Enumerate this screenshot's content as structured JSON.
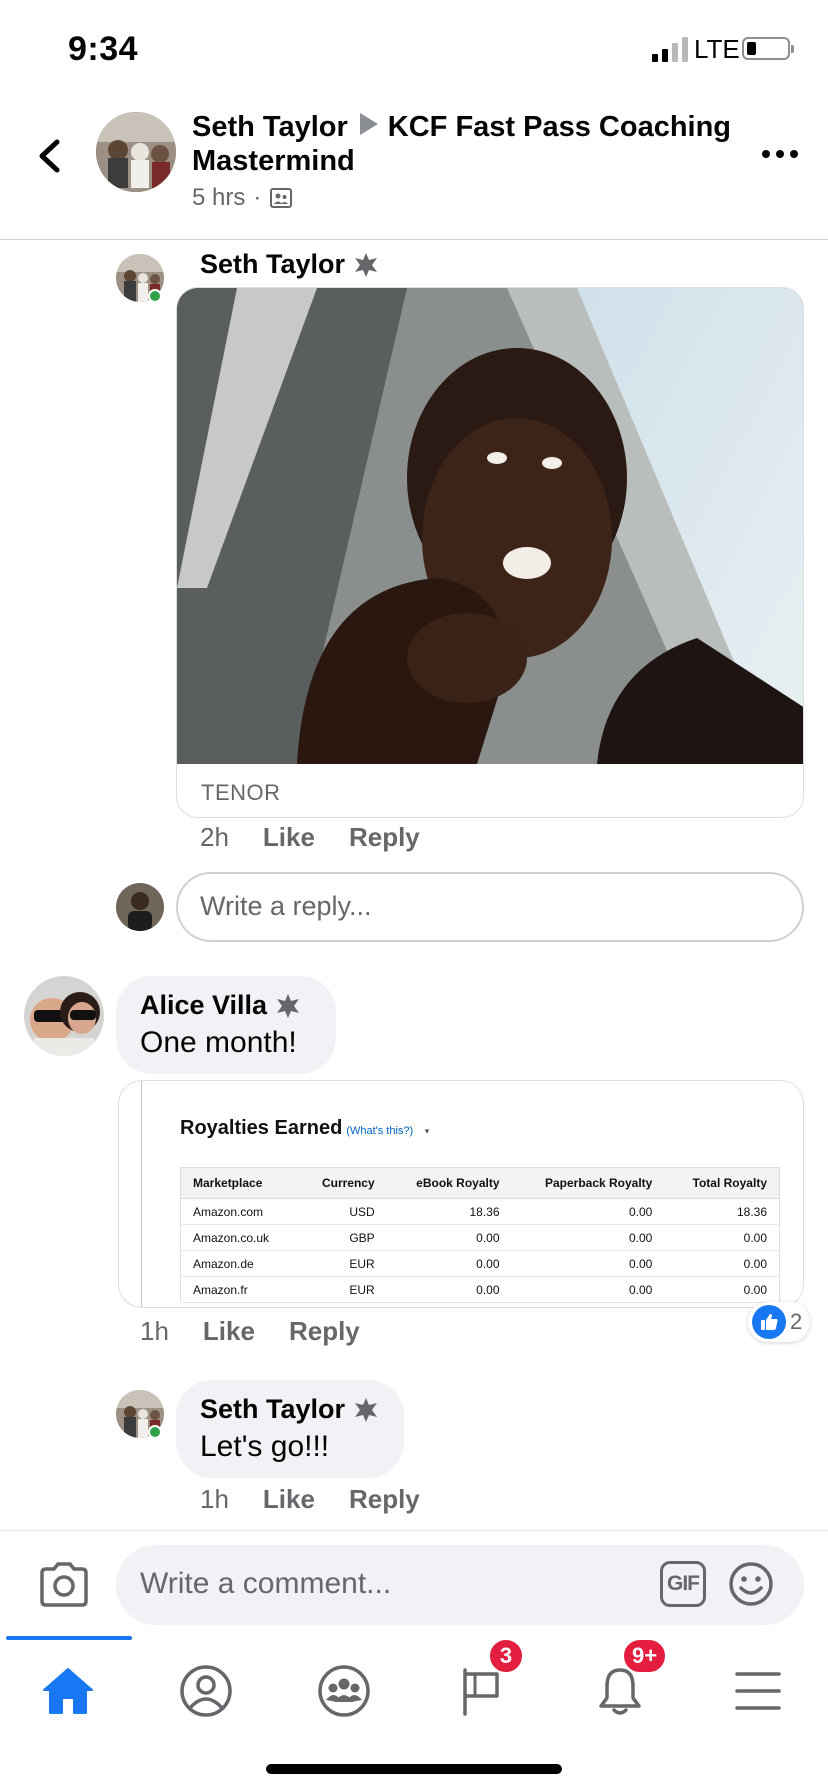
{
  "status_bar": {
    "time": "9:34",
    "network": "LTE"
  },
  "header": {
    "author": "Seth Taylor",
    "group": "KCF Fast Pass Coaching Mastermind",
    "time": "5 hrs",
    "audience_icon": "group-privacy-icon"
  },
  "comments": [
    {
      "author": "Seth Taylor",
      "attachment": {
        "type": "gif",
        "source": "TENOR"
      },
      "actions": {
        "time": "2h",
        "like": "Like",
        "reply": "Reply"
      }
    },
    {
      "author": "Alice Villa",
      "text": "One month!",
      "attachment": {
        "type": "image",
        "title": "Royalties Earned",
        "link": "(What's this?)",
        "columns": [
          "Marketplace",
          "Currency",
          "eBook Royalty",
          "Paperback Royalty",
          "Total Royalty"
        ],
        "rows": [
          [
            "Amazon.com",
            "USD",
            "18.36",
            "0.00",
            "18.36"
          ],
          [
            "Amazon.co.uk",
            "GBP",
            "0.00",
            "0.00",
            "0.00"
          ],
          [
            "Amazon.de",
            "EUR",
            "0.00",
            "0.00",
            "0.00"
          ],
          [
            "Amazon.fr",
            "EUR",
            "0.00",
            "0.00",
            "0.00"
          ]
        ]
      },
      "actions": {
        "time": "1h",
        "like": "Like",
        "reply": "Reply"
      },
      "reactions": {
        "icon": "like-icon",
        "count": "2"
      }
    },
    {
      "author": "Seth Taylor",
      "text": "Let's go!!!",
      "actions": {
        "time": "1h",
        "like": "Like",
        "reply": "Reply"
      }
    }
  ],
  "reply_input": {
    "placeholder": "Write a reply..."
  },
  "composer": {
    "placeholder": "Write a comment...",
    "gif_label": "GIF"
  },
  "tab_bar": {
    "tabs": [
      {
        "name": "home-icon",
        "active": true
      },
      {
        "name": "profile-icon"
      },
      {
        "name": "groups-icon"
      },
      {
        "name": "pages-flag-icon",
        "badge": "3"
      },
      {
        "name": "notifications-bell-icon",
        "badge": "9+"
      },
      {
        "name": "menu-icon"
      }
    ]
  },
  "colors": {
    "accent": "#1877f2",
    "badge": "#e41e3f",
    "online": "#31a24c",
    "bubble": "#f0f2f5",
    "secondary_text": "#65676b"
  }
}
